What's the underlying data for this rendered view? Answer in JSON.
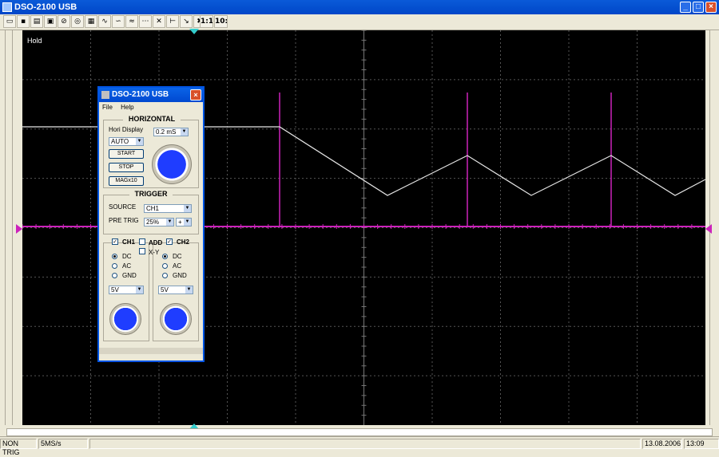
{
  "window": {
    "title": "DSO-2100 USB",
    "minimize": "_",
    "maximize": "□",
    "close": "×"
  },
  "toolbar": {
    "ratio_1_1": "1:1",
    "ratio_10_1": "10:1"
  },
  "screen": {
    "hold_label": "Hold"
  },
  "dialog": {
    "title": "DSO-2100 USB",
    "close": "×",
    "menu": {
      "file": "File",
      "help": "Help"
    },
    "horizontal": {
      "title": "HORIZONTAL",
      "hori_display_label": "Hori Display",
      "mode_value": "AUTO",
      "timebase_value": "0.2 mS",
      "start": "START",
      "stop": "STOP",
      "mag": "MAGx10"
    },
    "trigger": {
      "title": "TRIGGER",
      "source_label": "SOURCE",
      "source_value": "CH1",
      "pretrig_label": "PRE TRIG",
      "pretrig_value": "25%",
      "slope_value": "+"
    },
    "channels": {
      "ch1_label": "CH1",
      "add_label": "ADD",
      "xy_label": "X-Y",
      "ch2_label": "CH2",
      "ch1_dc": "DC",
      "ch1_ac": "AC",
      "ch1_gnd": "GND",
      "ch2_dc": "DC",
      "ch2_ac": "AC",
      "ch2_gnd": "GND",
      "ch1_volts": "5V",
      "ch2_volts": "5V"
    }
  },
  "status": {
    "trig": "NON TRIG",
    "rate": "5MS/s",
    "date": "13.08.2006",
    "time": "13:09"
  },
  "colors": {
    "screen_bg": "#000000",
    "trace_white": "#e6e6e6",
    "trace_magenta": "#cc22bb",
    "marker_cyan": "#33cccc"
  }
}
